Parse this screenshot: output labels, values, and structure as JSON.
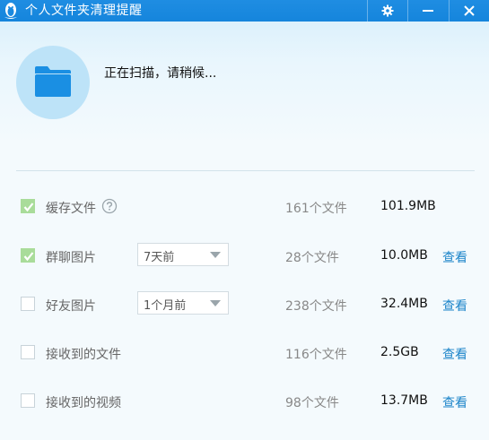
{
  "window": {
    "title": "个人文件夹清理提醒",
    "controls": [
      "settings-icon",
      "minimize-icon",
      "close-icon"
    ]
  },
  "scan": {
    "status": "正在扫描，请稍候..."
  },
  "rows": [
    {
      "label": "缓存文件",
      "checked": true,
      "has_help": true,
      "select": null,
      "count": "161个文件",
      "size": "101.9MB",
      "view": null
    },
    {
      "label": "群聊图片",
      "checked": true,
      "has_help": false,
      "select": "7天前",
      "count": "28个文件",
      "size": "10.0MB",
      "view": "查看"
    },
    {
      "label": "好友图片",
      "checked": false,
      "has_help": false,
      "select": "1个月前",
      "count": "238个文件",
      "size": "32.4MB",
      "view": "查看"
    },
    {
      "label": "接收到的文件",
      "checked": false,
      "has_help": false,
      "select": null,
      "count": "116个文件",
      "size": "2.5GB",
      "view": "查看"
    },
    {
      "label": "接收到的视频",
      "checked": false,
      "has_help": false,
      "select": null,
      "count": "98个文件",
      "size": "13.7MB",
      "view": "查看"
    }
  ],
  "colors": {
    "titlebar": "#1b89df",
    "accent_link": "#1b84c9",
    "checkbox_checked": "#a9dc9a",
    "folder_icon": "#1a8fe3"
  }
}
